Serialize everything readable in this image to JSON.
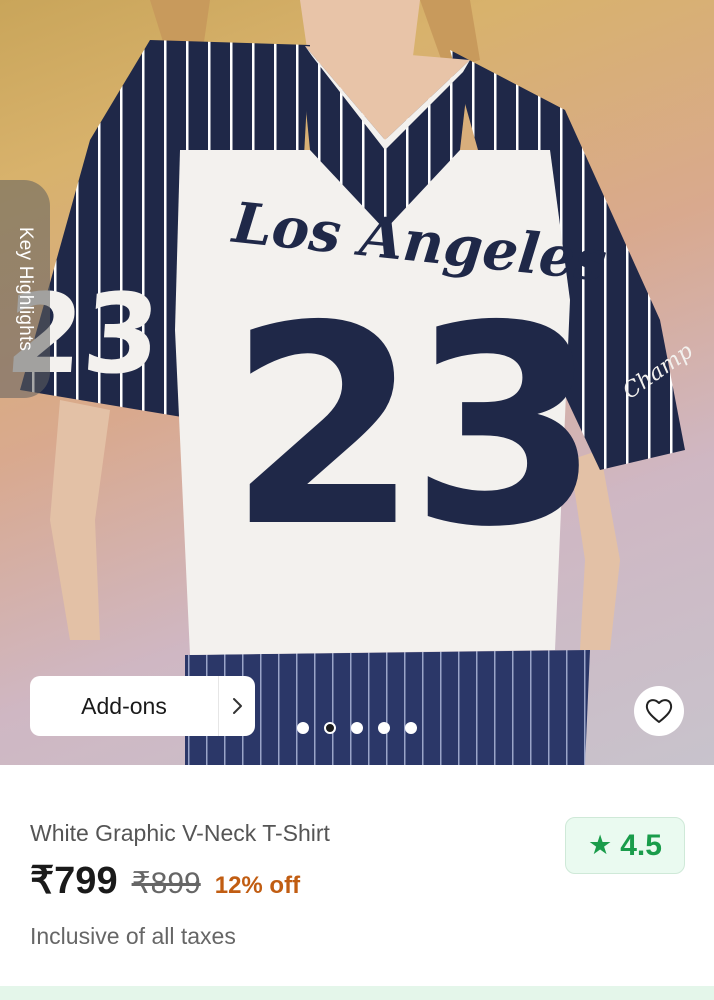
{
  "gallery": {
    "key_highlights_label": "Key Highlights",
    "addons_label": "Add-ons",
    "image_count": 5,
    "active_index": 1,
    "shirt_text": "Los Angeles",
    "shirt_number": "23",
    "sleeve_text": "Champ"
  },
  "product": {
    "title": "White Graphic V-Neck T-Shirt",
    "price": "₹799",
    "mrp": "₹899",
    "discount": "12% off",
    "tax_note": "Inclusive of all taxes",
    "rating": "4.5",
    "rating_icon": "star-icon"
  },
  "colors": {
    "navy": "#1f2848",
    "discount": "#c15d12",
    "rating_green": "#1a9c4b"
  }
}
